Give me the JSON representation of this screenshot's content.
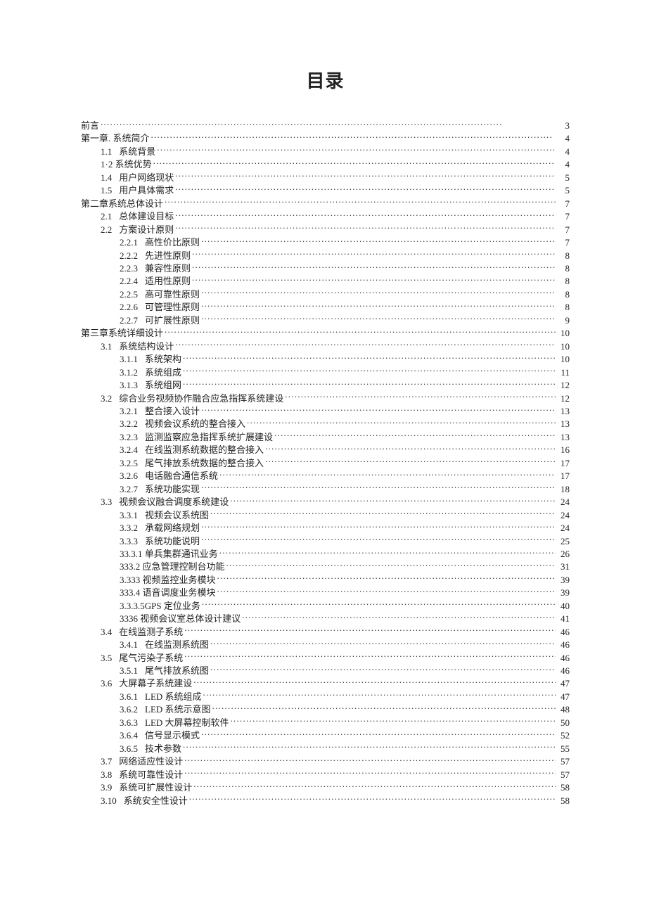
{
  "title": "目录",
  "entries": [
    {
      "indent": 0,
      "num": "",
      "label": "前言",
      "page": "3"
    },
    {
      "indent": 0,
      "num": "",
      "label": "第一章. 系统简介",
      "page": "4"
    },
    {
      "indent": 1,
      "num": "1.1",
      "label": "系统背景",
      "page": "4"
    },
    {
      "indent": 1,
      "num": "",
      "label": "1·2 系统优势",
      "page": "4"
    },
    {
      "indent": 1,
      "num": "1.4",
      "label": "用户网络现状",
      "page": "5"
    },
    {
      "indent": 1,
      "num": "1.5",
      "label": "用户具体需求",
      "page": "5"
    },
    {
      "indent": 0,
      "num": "",
      "label": "第二章系统总体设计",
      "page": "7"
    },
    {
      "indent": 1,
      "num": "2.1",
      "label": "总体建设目标",
      "page": "7"
    },
    {
      "indent": 1,
      "num": "2.2",
      "label": "方案设计原则",
      "page": "7"
    },
    {
      "indent": 2,
      "num": "2.2.1",
      "label": "高性价比原则",
      "page": "7"
    },
    {
      "indent": 2,
      "num": "2.2.2",
      "label": "先进性原则",
      "page": "8"
    },
    {
      "indent": 2,
      "num": "2.2.3",
      "label": "兼容性原则",
      "page": "8"
    },
    {
      "indent": 2,
      "num": "2.2.4",
      "label": "适用性原则",
      "page": "8"
    },
    {
      "indent": 2,
      "num": "2.2.5",
      "label": "高可靠性原则",
      "page": "8"
    },
    {
      "indent": 2,
      "num": "2.2.6",
      "label": "可管理性原则",
      "page": "8"
    },
    {
      "indent": 2,
      "num": "2.2.7",
      "label": "可扩展性原则",
      "page": "9"
    },
    {
      "indent": 0,
      "num": "",
      "label": "第三章系统详细设计",
      "page": "10"
    },
    {
      "indent": 1,
      "num": "3.1",
      "label": "系统结构设计",
      "page": "10"
    },
    {
      "indent": 2,
      "num": "3.1.1",
      "label": "系统架构",
      "page": "10"
    },
    {
      "indent": 2,
      "num": "3.1.2",
      "label": "系统组成",
      "page": "11"
    },
    {
      "indent": 2,
      "num": "3.1.3",
      "label": "系统组网",
      "page": "12"
    },
    {
      "indent": 1,
      "num": "3.2",
      "label": "综合业务视频协作融合应急指挥系统建设",
      "page": "12"
    },
    {
      "indent": 2,
      "num": "3.2.1",
      "label": "整合接入设计",
      "page": "13"
    },
    {
      "indent": 2,
      "num": "3.2.2",
      "label": "视频会议系统的整合接入",
      "page": "13"
    },
    {
      "indent": 2,
      "num": "3.2.3",
      "label": "监测监察应急指挥系统扩展建设",
      "page": "13"
    },
    {
      "indent": 2,
      "num": "3.2.4",
      "label": "在线监测系统数据的整合接入",
      "page": "16"
    },
    {
      "indent": 2,
      "num": "3.2.5",
      "label": "尾气排放系统数据的整合接入",
      "page": "17"
    },
    {
      "indent": 2,
      "num": "3.2.6",
      "label": "电话融合通信系统",
      "page": "17"
    },
    {
      "indent": 2,
      "num": "3.2.7",
      "label": "系统功能实现",
      "page": "18"
    },
    {
      "indent": 1,
      "num": "3.3",
      "label": "视频会议融合调度系统建设",
      "page": "24"
    },
    {
      "indent": 2,
      "num": "3.3.1",
      "label": "视频会议系统图",
      "page": "24"
    },
    {
      "indent": 2,
      "num": "3.3.2",
      "label": "承载网络规划",
      "page": "24"
    },
    {
      "indent": 2,
      "num": "3.3.3",
      "label": "系统功能说明",
      "page": "25"
    },
    {
      "indent": 2,
      "num": "",
      "label": "33.3.1 单兵集群通讯业务",
      "page": "26"
    },
    {
      "indent": 2,
      "num": "",
      "label": "333.2 应急管理控制台功能",
      "page": "31"
    },
    {
      "indent": 2,
      "num": "",
      "label": "3.333 视频监控业务模块",
      "page": "39"
    },
    {
      "indent": 2,
      "num": "",
      "label": "333.4 语音调度业务模块",
      "page": "39"
    },
    {
      "indent": 2,
      "num": "",
      "label": "3.3.3.5GPS 定位业务",
      "page": "40"
    },
    {
      "indent": 2,
      "num": "",
      "label": "3336 视频会议室总体设计建议",
      "page": "41"
    },
    {
      "indent": 1,
      "num": "3.4",
      "label": "在线监测子系统",
      "page": "46"
    },
    {
      "indent": 2,
      "num": "3.4.1",
      "label": "在线监测系统图",
      "page": "46"
    },
    {
      "indent": 1,
      "num": "3.5",
      "label": "尾气污染子系统",
      "page": "46"
    },
    {
      "indent": 2,
      "num": "3.5.1",
      "label": "尾气排放系统图",
      "page": "46"
    },
    {
      "indent": 1,
      "num": "3.6",
      "label": "大屏幕子系统建设",
      "page": "47"
    },
    {
      "indent": 2,
      "num": "3.6.1",
      "label": "LED 系统组成",
      "page": "47"
    },
    {
      "indent": 2,
      "num": "3.6.2",
      "label": "LED 系统示意图",
      "page": "48"
    },
    {
      "indent": 2,
      "num": "3.6.3",
      "label": "LED 大屏幕控制软件",
      "page": "50"
    },
    {
      "indent": 2,
      "num": "3.6.4",
      "label": "信号显示模式",
      "page": "52"
    },
    {
      "indent": 2,
      "num": "3.6.5",
      "label": "技术参数",
      "page": "55"
    },
    {
      "indent": 1,
      "num": "3.7",
      "label": "网络适应性设计",
      "page": "57"
    },
    {
      "indent": 1,
      "num": "3.8",
      "label": "系统可靠性设计",
      "page": "57"
    },
    {
      "indent": 1,
      "num": "3.9",
      "label": "系统可扩展性设计",
      "page": "58"
    },
    {
      "indent": 1,
      "num": "3.10",
      "label": "系统安全性设计",
      "page": "58"
    }
  ]
}
